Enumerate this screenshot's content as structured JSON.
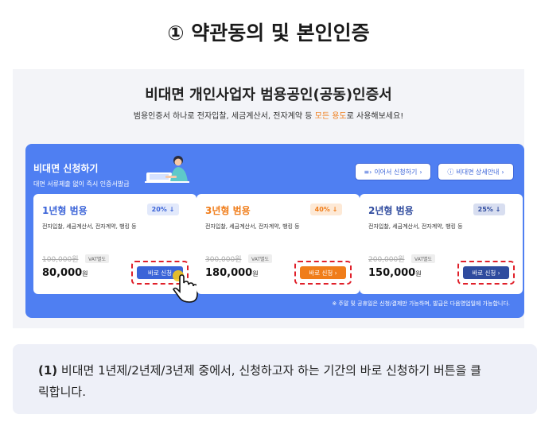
{
  "step_title": "① 약관동의 및 본인인증",
  "panel": {
    "title": "비대면 개인사업자 범용공인(공동)인증서",
    "subtitle_pre": "범용인증서 하나로 전자입찰, 세금계산서, 전자계약 등 ",
    "subtitle_highlight": "모든 용도",
    "subtitle_post": "로 사용해보세요!"
  },
  "blue": {
    "title": "비대면 신청하기",
    "desc": "대면 서류제출 없이 즉시 인증서발급",
    "continue_btn": "이어서 신청하기",
    "detail_btn": "비대면 상세안내",
    "note": "※ 주말 및 공휴일은 신청/결제만 가능하며, 발급은 다음영업일에 가능합니다."
  },
  "cards": [
    {
      "name": "1년형 범용",
      "discount": "20% ↓",
      "desc": "전자입찰, 세금계산서, 전자계약, 뱅킹 등",
      "original_price": "100,000원",
      "vat": "VAT별도",
      "price": "80,000",
      "won": "원",
      "apply": "바로 신청"
    },
    {
      "name": "3년형 범용",
      "discount": "40% ↓",
      "desc": "전자입찰, 세금계산서, 전자계약, 뱅킹 등",
      "original_price": "300,000원",
      "vat": "VAT별도",
      "price": "180,000",
      "won": "원",
      "apply": "바로 신청 ›"
    },
    {
      "name": "2년형 범용",
      "discount": "25% ↓",
      "desc": "전자입찰, 세금계산서, 전자계약, 뱅킹 등",
      "original_price": "200,000원",
      "vat": "VAT별도",
      "price": "150,000",
      "won": "원",
      "apply": "바로 신청 ›"
    }
  ],
  "description": {
    "num": "(1)",
    "text": " 비대면 1년제/2년제/3년제 중에서, 신청하고자 하는 기간의 바로 신청하기 버튼을 클릭합니다."
  },
  "colors": {
    "blue_panel": "#4f7ff2",
    "orange": "#f07d1a",
    "navy": "#2f4b9e",
    "dashed_red": "#e0202a"
  }
}
